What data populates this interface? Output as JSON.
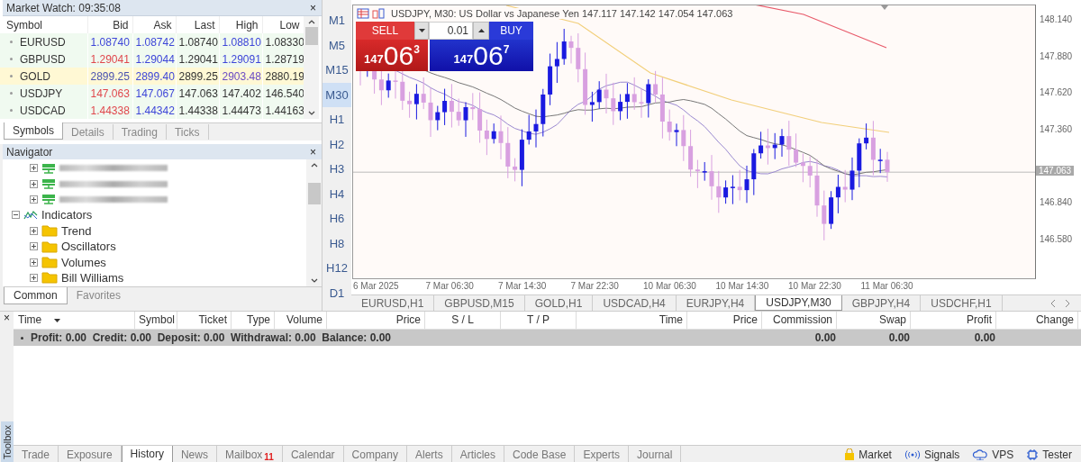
{
  "market_watch": {
    "title": "Market Watch: 09:35:08",
    "close": "×",
    "columns": [
      "Symbol",
      "Bid",
      "Ask",
      "Last",
      "High",
      "Low"
    ],
    "rows": [
      {
        "selected": false,
        "cells": [
          {
            "text": "EURUSD"
          },
          {
            "text": "1.08740",
            "color": "#3d45d8"
          },
          {
            "text": "1.08742",
            "color": "#3d45d8"
          },
          {
            "text": "1.08740",
            "color": "#333333"
          },
          {
            "text": "1.08810",
            "color": "#3d45d8"
          },
          {
            "text": "1.08330",
            "color": "#333333"
          }
        ]
      },
      {
        "selected": false,
        "cells": [
          {
            "text": "GBPUSD"
          },
          {
            "text": "1.29041",
            "color": "#e0474c"
          },
          {
            "text": "1.29044",
            "color": "#3d45d8"
          },
          {
            "text": "1.29041",
            "color": "#333333"
          },
          {
            "text": "1.29091",
            "color": "#3d45d8"
          },
          {
            "text": "1.28719",
            "color": "#333333"
          }
        ]
      },
      {
        "selected": true,
        "cells": [
          {
            "text": "GOLD"
          },
          {
            "text": "2899.25",
            "color": "#4a52b0"
          },
          {
            "text": "2899.40",
            "color": "#3d45d8"
          },
          {
            "text": "2899.25",
            "color": "#333333"
          },
          {
            "text": "2903.48",
            "color": "#6b4bc4"
          },
          {
            "text": "2880.19",
            "color": "#333333"
          }
        ]
      },
      {
        "selected": false,
        "cells": [
          {
            "text": "USDJPY"
          },
          {
            "text": "147.063",
            "color": "#e0474c"
          },
          {
            "text": "147.067",
            "color": "#3d45d8"
          },
          {
            "text": "147.063",
            "color": "#333333"
          },
          {
            "text": "147.402",
            "color": "#333333"
          },
          {
            "text": "146.540",
            "color": "#333333"
          }
        ]
      },
      {
        "selected": false,
        "cells": [
          {
            "text": "USDCAD"
          },
          {
            "text": "1.44338",
            "color": "#e0474c"
          },
          {
            "text": "1.44342",
            "color": "#3d45d8"
          },
          {
            "text": "1.44338",
            "color": "#333333"
          },
          {
            "text": "1.44473",
            "color": "#333333"
          },
          {
            "text": "1.44163",
            "color": "#333333"
          }
        ]
      }
    ],
    "tabs": [
      {
        "label": "Symbols",
        "selected": true
      },
      {
        "label": "Details",
        "selected": false
      },
      {
        "label": "Trading",
        "selected": false
      },
      {
        "label": "Ticks",
        "selected": false
      }
    ]
  },
  "navigator": {
    "title": "Navigator",
    "close": "×",
    "items": [
      {
        "kind": "account",
        "expanded": false
      },
      {
        "kind": "account",
        "expanded": false
      },
      {
        "kind": "account",
        "expanded": false
      },
      {
        "kind": "indicators",
        "label": "Indicators",
        "expanded": true,
        "children": [
          {
            "kind": "folder",
            "label": "Trend",
            "expanded": false
          },
          {
            "kind": "folder",
            "label": "Oscillators",
            "expanded": false
          },
          {
            "kind": "folder",
            "label": "Volumes",
            "expanded": false
          },
          {
            "kind": "folder",
            "label": "Bill Williams",
            "expanded": false
          }
        ]
      }
    ],
    "tabs": [
      {
        "label": "Common",
        "selected": true
      },
      {
        "label": "Favorites",
        "selected": false
      }
    ]
  },
  "timeframes": [
    {
      "label": "M1",
      "selected": false
    },
    {
      "label": "M5",
      "selected": false
    },
    {
      "label": "M15",
      "selected": false
    },
    {
      "label": "M30",
      "selected": true
    },
    {
      "label": "H1",
      "selected": false
    },
    {
      "label": "H2",
      "selected": false
    },
    {
      "label": "H3",
      "selected": false
    },
    {
      "label": "H4",
      "selected": false
    },
    {
      "label": "H6",
      "selected": false
    },
    {
      "label": "H8",
      "selected": false
    },
    {
      "label": "H12",
      "selected": false
    },
    {
      "label": "D1",
      "selected": false
    }
  ],
  "chart": {
    "title": "USDJPY, M30:  US Dollar vs Japanese Yen  147.117 147.142 147.054 147.063",
    "trade_panel": {
      "sell": "SELL",
      "buy": "BUY",
      "volume": "0.01",
      "sell_price": {
        "big": "147",
        "main": "06",
        "sup": "3"
      },
      "buy_price": {
        "big": "147",
        "main": "06",
        "sup": "7"
      }
    },
    "price_ticks": [
      "148.140",
      "147.880",
      "147.620",
      "147.360",
      "146.840",
      "146.580"
    ],
    "current_price": "147.063",
    "time_labels": [
      "6 Mar 2025",
      "7 Mar 06:30",
      "7 Mar 14:30",
      "7 Mar 22:30",
      "10 Mar 06:30",
      "10 Mar 14:30",
      "10 Mar 22:30",
      "11 Mar 06:30"
    ],
    "tabs": [
      {
        "label": "EURUSD,H1",
        "selected": false
      },
      {
        "label": "GBPUSD,M15",
        "selected": false
      },
      {
        "label": "GOLD,H1",
        "selected": false
      },
      {
        "label": "USDCAD,H4",
        "selected": false
      },
      {
        "label": "EURJPY,H4",
        "selected": false
      },
      {
        "label": "USDJPY,M30",
        "selected": true
      },
      {
        "label": "GBPJPY,H4",
        "selected": false
      },
      {
        "label": "USDCHF,H1",
        "selected": false
      }
    ]
  },
  "toolbox": {
    "label": "Toolbox",
    "close": "×",
    "columns": [
      "Time",
      "Symbol",
      "Ticket",
      "Type",
      "Volume",
      "Price",
      "S / L",
      "T / P",
      "Time",
      "Price",
      "Commission",
      "Swap",
      "Profit",
      "Change"
    ],
    "summary": {
      "text": "Profit: 0.00  Credit: 0.00  Deposit: 0.00  Withdrawal: 0.00  Balance: 0.00",
      "commission": "0.00",
      "swap": "0.00",
      "profit": "0.00"
    },
    "tabs": [
      {
        "label": "Trade",
        "selected": false
      },
      {
        "label": "Exposure",
        "selected": false
      },
      {
        "label": "History",
        "selected": true
      },
      {
        "label": "News",
        "selected": false
      },
      {
        "label": "Mailbox",
        "badge": "11",
        "selected": false
      },
      {
        "label": "Calendar",
        "selected": false
      },
      {
        "label": "Company",
        "selected": false
      },
      {
        "label": "Alerts",
        "selected": false
      },
      {
        "label": "Articles",
        "selected": false
      },
      {
        "label": "Code Base",
        "selected": false
      },
      {
        "label": "Experts",
        "selected": false
      },
      {
        "label": "Journal",
        "selected": false
      }
    ],
    "links": [
      {
        "kind": "market",
        "label": "Market"
      },
      {
        "kind": "signals",
        "label": "Signals"
      },
      {
        "kind": "vps",
        "label": "VPS"
      },
      {
        "kind": "tester",
        "label": "Tester"
      }
    ]
  }
}
